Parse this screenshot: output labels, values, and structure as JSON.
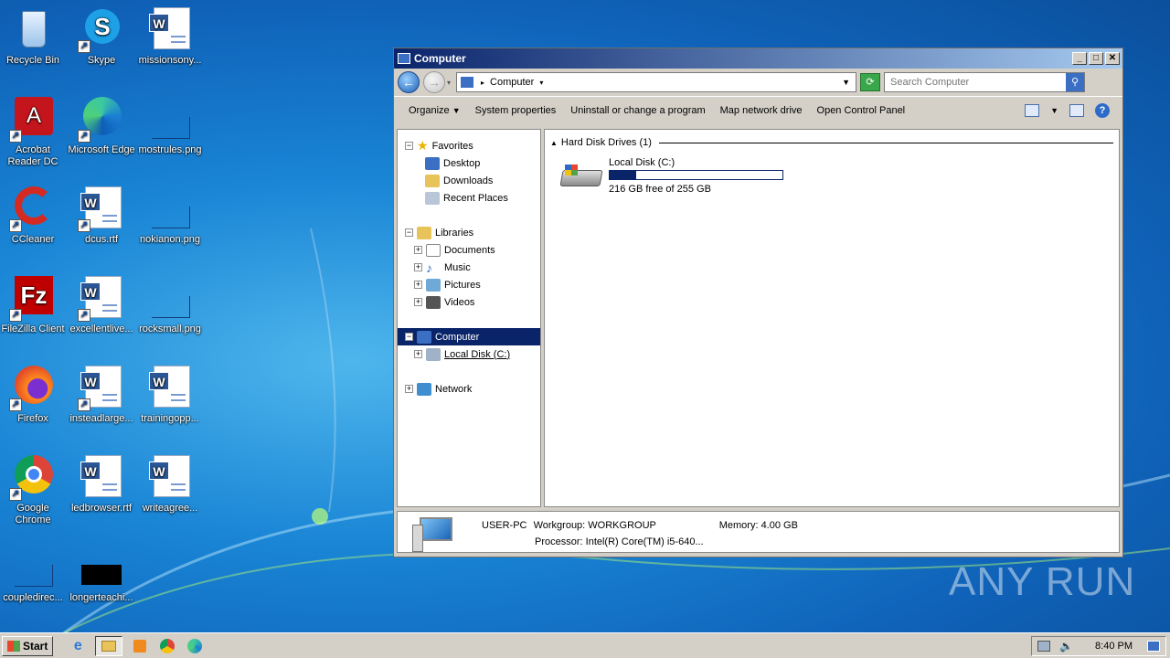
{
  "desktop": {
    "icons": [
      {
        "label": "Recycle Bin",
        "icon": "recycle-bin-icon"
      },
      {
        "label": "Skype",
        "icon": "skype-icon"
      },
      {
        "label": "missionsony...",
        "icon": "word-document-icon"
      },
      {
        "label": "Acrobat Reader DC",
        "icon": "acrobat-icon"
      },
      {
        "label": "Microsoft Edge",
        "icon": "edge-icon"
      },
      {
        "label": "mostrules.png",
        "icon": "image-thumbnail-icon"
      },
      {
        "label": "CCleaner",
        "icon": "ccleaner-icon"
      },
      {
        "label": "dcus.rtf",
        "icon": "word-document-icon"
      },
      {
        "label": "nokianon.png",
        "icon": "image-thumbnail-icon"
      },
      {
        "label": "FileZilla Client",
        "icon": "filezilla-icon"
      },
      {
        "label": "excellentlive...",
        "icon": "word-document-icon"
      },
      {
        "label": "rocksmall.png",
        "icon": "image-thumbnail-icon"
      },
      {
        "label": "Firefox",
        "icon": "firefox-icon"
      },
      {
        "label": "insteadlarge...",
        "icon": "word-document-icon"
      },
      {
        "label": "trainingopp...",
        "icon": "word-document-icon"
      },
      {
        "label": "Google Chrome",
        "icon": "chrome-icon"
      },
      {
        "label": "ledbrowser.rtf",
        "icon": "word-document-icon"
      },
      {
        "label": "writeagree...",
        "icon": "word-document-icon"
      },
      {
        "label": "coupledirec...",
        "icon": "image-thumbnail-icon"
      },
      {
        "label": "longerteachi...",
        "icon": "image-thumbnail-icon"
      }
    ]
  },
  "window": {
    "title": "Computer",
    "address": "Computer",
    "search_placeholder": "Search Computer",
    "commands": [
      "Organize",
      "System properties",
      "Uninstall or change a program",
      "Map network drive",
      "Open Control Panel"
    ],
    "nav": {
      "favorites": "Favorites",
      "desktop": "Desktop",
      "downloads": "Downloads",
      "recent": "Recent Places",
      "libraries": "Libraries",
      "documents": "Documents",
      "music": "Music",
      "pictures": "Pictures",
      "videos": "Videos",
      "computer": "Computer",
      "local_disk": "Local Disk (C:)",
      "network": "Network"
    },
    "main": {
      "group": "Hard Disk Drives (1)",
      "drive_name": "Local Disk (C:)",
      "drive_free": "216 GB free of 255 GB",
      "drive_used_fraction": 0.153
    },
    "details": {
      "pc_name": "USER-PC",
      "workgroup_label": "Workgroup:",
      "workgroup": "WORKGROUP",
      "memory_label": "Memory:",
      "memory": "4.00 GB",
      "processor_label": "Processor:",
      "processor": "Intel(R) Core(TM) i5-640..."
    }
  },
  "taskbar": {
    "start": "Start",
    "clock": "8:40 PM"
  },
  "watermark": "ANY RUN"
}
